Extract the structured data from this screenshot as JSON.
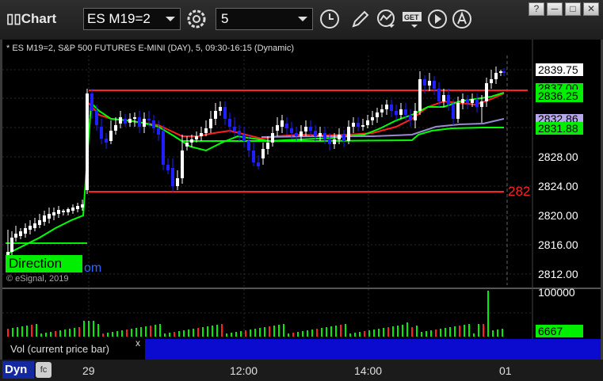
{
  "app": {
    "title": "Chart"
  },
  "toolbar": {
    "symbol": "ES M19=2",
    "interval": "5",
    "icons": [
      "settings-gear-icon",
      "clock-icon",
      "pencil-icon",
      "study-icon",
      "get-icon",
      "play-icon",
      "font-icon"
    ]
  },
  "window_controls": [
    "?",
    "─",
    "□",
    "✕"
  ],
  "chart": {
    "description": "* ES M19=2, S&P 500 FUTURES E-MINI (DAY), 5, 09:30-16:15 (Dynamic)",
    "copyright": "© eSignal, 2019",
    "direction_label": "Direction",
    "direction_suffix": "om",
    "red_level_label": "282",
    "y_axis": [
      "2828.00",
      "2824.00",
      "2820.00",
      "2816.00",
      "2812.00"
    ],
    "price_flags": {
      "last": "2839.75",
      "green_upper": "2837.00",
      "red": "2836.25",
      "purple": "2832.86",
      "green_lower": "2831.88"
    },
    "x_axis": [
      "29",
      "12:00",
      "14:00",
      "01"
    ],
    "colors": {
      "background": "#000000",
      "up_candle": "#ffffff",
      "down_candle": "#2020ff",
      "red_line": "#ff2020",
      "green_line": "#00ff00",
      "purple_line": "#9a8ad0"
    }
  },
  "volume": {
    "label": "Vol (current price bar)",
    "close": "x",
    "y_axis": [
      "100000"
    ],
    "last_flag": "6667"
  },
  "bottom": {
    "dyn": "Dyn"
  }
}
